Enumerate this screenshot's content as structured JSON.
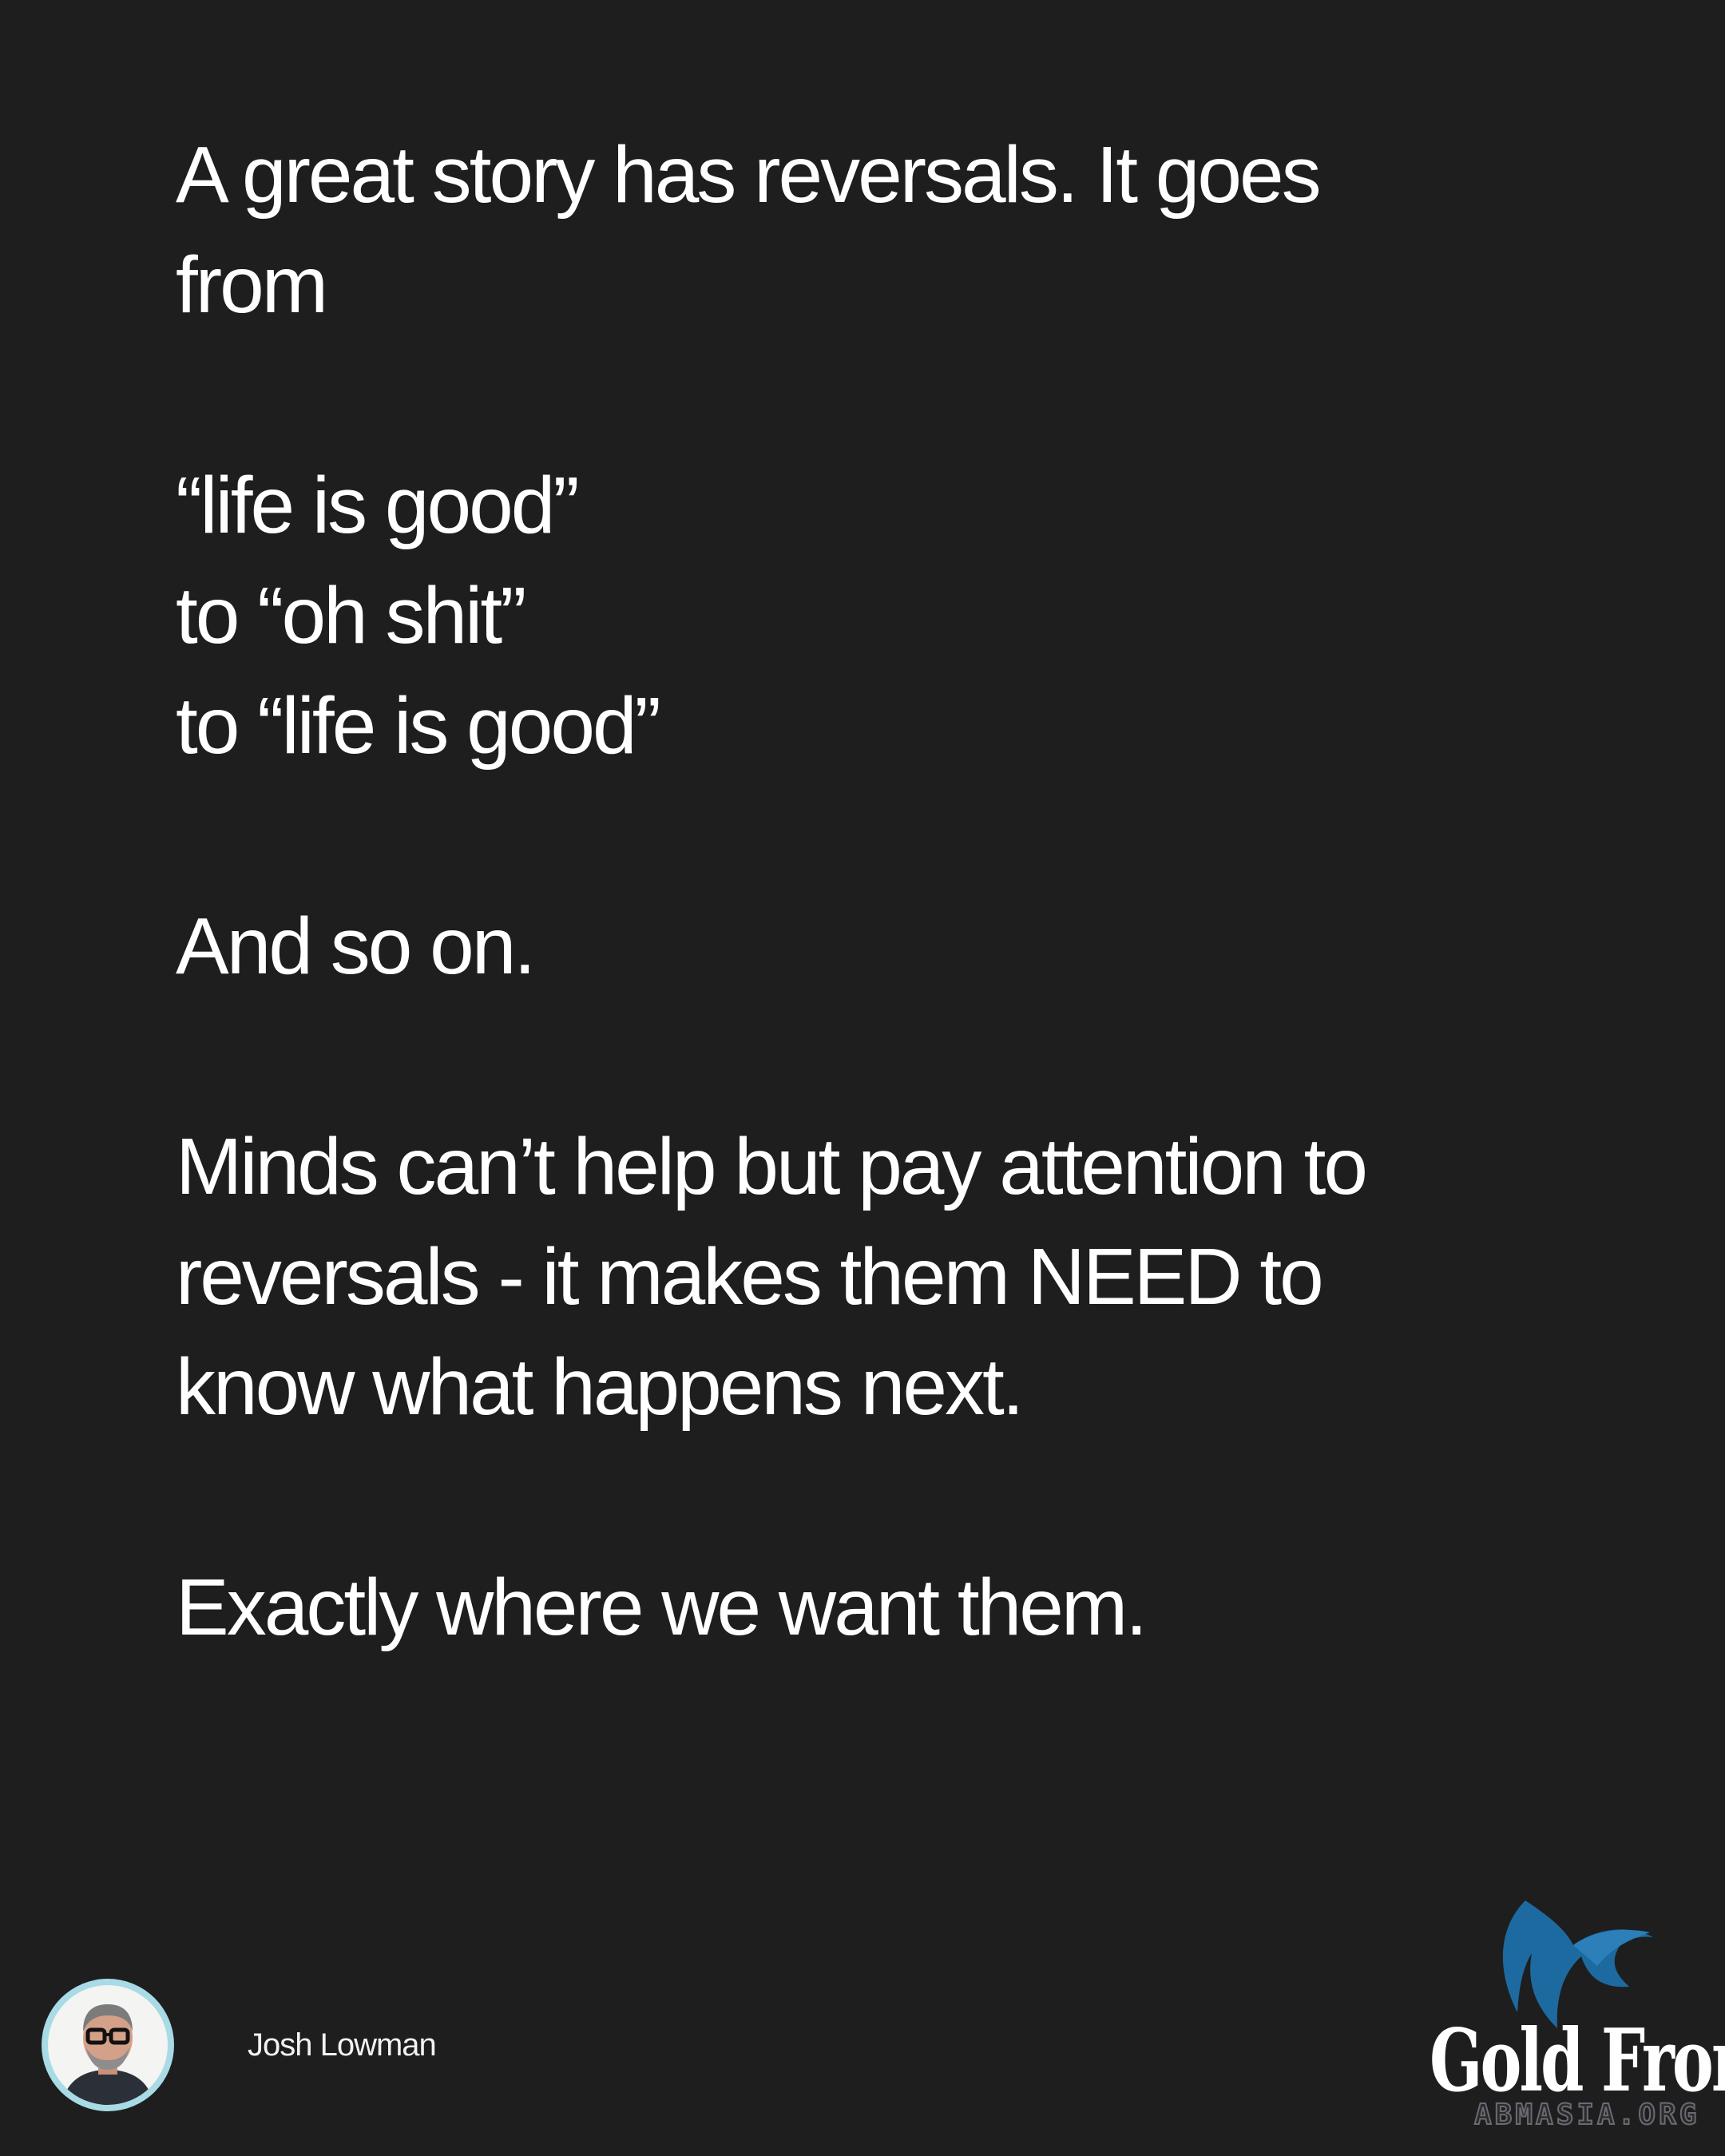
{
  "post": {
    "paragraphs": [
      {
        "lines": [
          "A great story has reversals. It goes",
          "from"
        ]
      },
      {
        "lines": [
          "“life is good”",
          "to “oh shit”",
          "to “life is good”"
        ]
      },
      {
        "lines": [
          "And so on."
        ]
      },
      {
        "lines": [
          "Minds can’t help but pay attention to",
          "reversals - it makes them NEED to",
          "know what happens next."
        ]
      },
      {
        "lines": [
          "Exactly where we want them."
        ]
      }
    ]
  },
  "author": {
    "name": "Josh Lowman",
    "avatar_icon": "person-portrait-icon",
    "avatar_ring_color": "#a8dbe6"
  },
  "brand": {
    "logo_icon": "bird-wing-icon",
    "wordmark": "Gold Front",
    "site": "ABMASIA.ORG",
    "logo_color": "#1e6fa8"
  },
  "colors": {
    "background": "#1e1e1f",
    "text": "#ffffff"
  }
}
